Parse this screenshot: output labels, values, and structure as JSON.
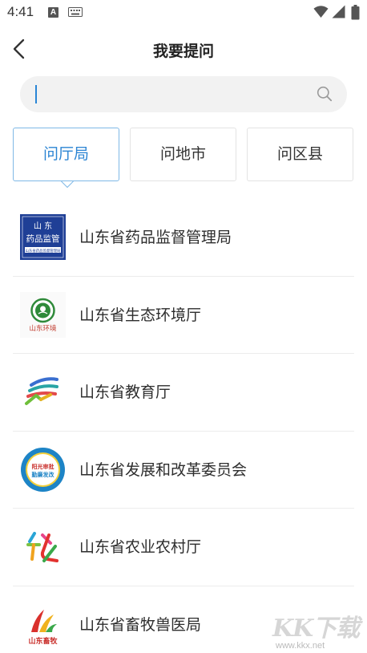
{
  "status_bar": {
    "time": "4:41",
    "notification_badge": "A",
    "icons": [
      "keyboard-icon",
      "wifi-icon",
      "signal-icon",
      "battery-icon"
    ]
  },
  "header": {
    "title": "我要提问",
    "back_icon": "chevron-left-icon"
  },
  "search": {
    "value": "",
    "placeholder": "",
    "icon": "search-icon"
  },
  "tabs": [
    {
      "label": "问厅局",
      "active": true
    },
    {
      "label": "问地市",
      "active": false
    },
    {
      "label": "问区县",
      "active": false
    }
  ],
  "departments": [
    {
      "name": "山东省药品监督管理局",
      "logo": {
        "line1": "山 东",
        "line2": "药品监管",
        "line3": "山东省药品监督管理局"
      }
    },
    {
      "name": "山东省生态环境厅",
      "logo": {
        "caption": "山东环境"
      }
    },
    {
      "name": "山东省教育厅",
      "logo": {}
    },
    {
      "name": "山东省发展和改革委员会",
      "logo": {
        "line1": "阳光审批",
        "line2": "勤廉发改"
      }
    },
    {
      "name": "山东省农业农村厅",
      "logo": {}
    },
    {
      "name": "山东省畜牧兽医局",
      "logo": {
        "caption": "山东畜牧"
      }
    }
  ],
  "watermark": {
    "brand": "KK下载",
    "url": "www.kkx.net"
  },
  "colors": {
    "accent": "#2b84d3",
    "tab_active_border": "#7fb8e6",
    "search_bg": "#f2f2f2",
    "divider": "#ececec"
  }
}
